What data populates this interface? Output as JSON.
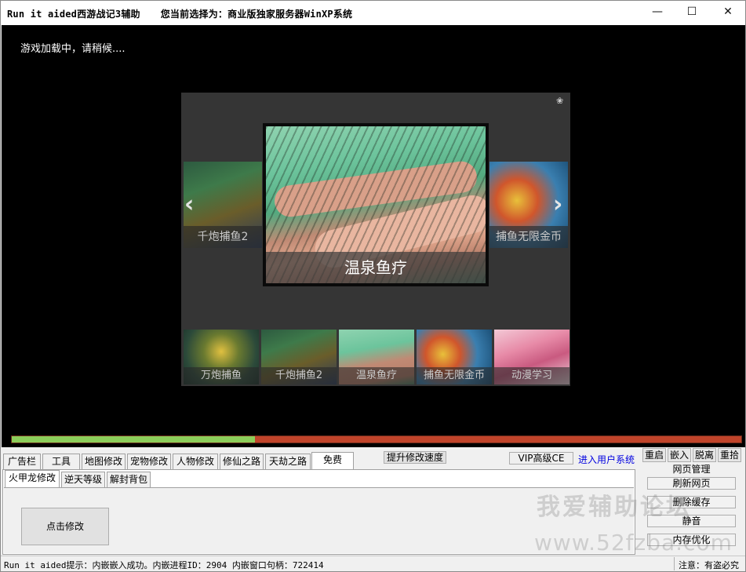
{
  "window": {
    "app_title": "Run it aided西游战记3辅助",
    "selection_text": "您当前选择为：商业版独家服务器WinXP系统",
    "controls": {
      "minimize": "—",
      "maximize": "☐",
      "close": "✕"
    }
  },
  "game": {
    "loading_text": "游戏加载中，请稍候....",
    "progress_percent": 33.3,
    "progress_colors": {
      "fill": "#8ccd5a",
      "track": "#c0442a"
    },
    "carousel": {
      "main_caption": "温泉鱼疗",
      "left_caption": "千炮捕鱼2",
      "right_caption": "捕鱼无限金币",
      "prev_arrow": "‹",
      "next_arrow": "›",
      "paw_icon": "❀",
      "thumbnails": [
        "万炮捕鱼",
        "千炮捕鱼2",
        "温泉鱼疗",
        "捕鱼无限金币",
        "动漫学习"
      ]
    }
  },
  "tabs": [
    "广告栏",
    "工具",
    "地图修改",
    "宠物修改",
    "人物修改",
    "修仙之路",
    "天劫之路",
    "免费"
  ],
  "active_tab": "免费",
  "toolbar": {
    "speed_button": "提升修改速度",
    "vip_button": "VIP高级CE",
    "user_link": "进入用户系统",
    "restart": "重启",
    "embed": "嵌入",
    "detach": "脱离",
    "pick_up": "重拾"
  },
  "subtabs": [
    "火甲龙修改",
    "逆天等级",
    "解封背包"
  ],
  "active_subtab": "火甲龙修改",
  "action_button": "点击修改",
  "side_buttons": [
    "网页管理",
    "刷新网页",
    "删除缓存",
    "静音",
    "内存优化"
  ],
  "watermark": {
    "line1": "我爱辅助论坛",
    "line2": "www.52fzba.com"
  },
  "status": {
    "left": "Run it aided提示：内嵌嵌入成功。内嵌进程ID：2904 内嵌窗口句柄：722414",
    "right": "注意：有盗必究"
  }
}
